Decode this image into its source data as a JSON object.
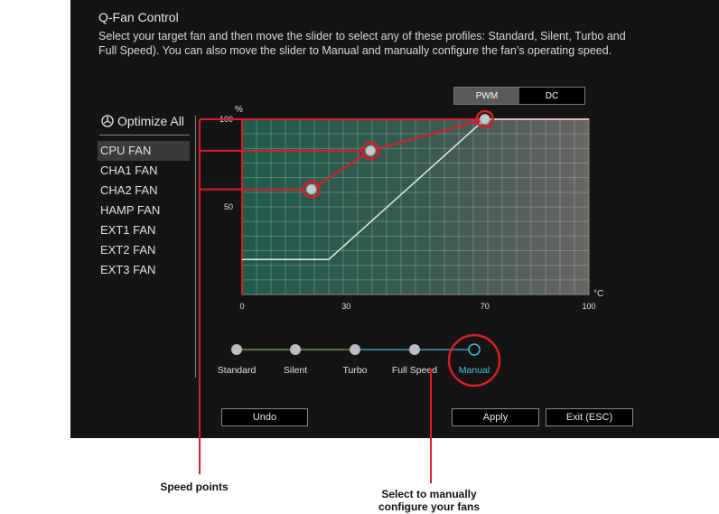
{
  "header": {
    "title": "Q-Fan Control",
    "description": "Select your target fan and then move the slider to select any of these profiles: Standard, Silent, Turbo and\nFull Speed). You can also move the slider to Manual and manually configure the fan’s operating speed."
  },
  "mode_toggle": {
    "options": [
      "PWM",
      "DC"
    ],
    "selected": "PWM"
  },
  "sidebar": {
    "optimize_all": "Optimize All",
    "fans": [
      "CPU FAN",
      "CHA1 FAN",
      "CHA2 FAN",
      "HAMP FAN",
      "EXT1 FAN",
      "EXT2 FAN",
      "EXT3 FAN"
    ],
    "selected_fan": "CPU FAN"
  },
  "chart_data": {
    "type": "line",
    "y_unit": "%",
    "x_unit": "°C",
    "x_ticks": [
      "0",
      "30",
      "70",
      "100"
    ],
    "y_ticks": [
      "50",
      "100"
    ],
    "xlim": [
      0,
      100
    ],
    "ylim": [
      0,
      100
    ],
    "grid": true,
    "series": [
      {
        "values": [
          [
            0,
            20
          ],
          [
            25,
            20
          ],
          [
            70,
            100
          ],
          [
            100,
            100
          ]
        ]
      }
    ],
    "speed_points": [
      [
        20,
        60
      ],
      [
        37,
        82
      ],
      [
        70,
        100
      ]
    ]
  },
  "profiles": {
    "options": [
      "Standard",
      "Silent",
      "Turbo",
      "Full Speed",
      "Manual"
    ],
    "selected": "Manual"
  },
  "buttons": {
    "undo": "Undo",
    "apply": "Apply",
    "exit": "Exit (ESC)"
  },
  "callouts": {
    "speed_points": "Speed points",
    "manual": "Select to manually\nconfigure your fans"
  },
  "colors": {
    "accent": "#d91e26",
    "curve": "#e8e8e8",
    "selected_profile": "#3fc6d6"
  }
}
